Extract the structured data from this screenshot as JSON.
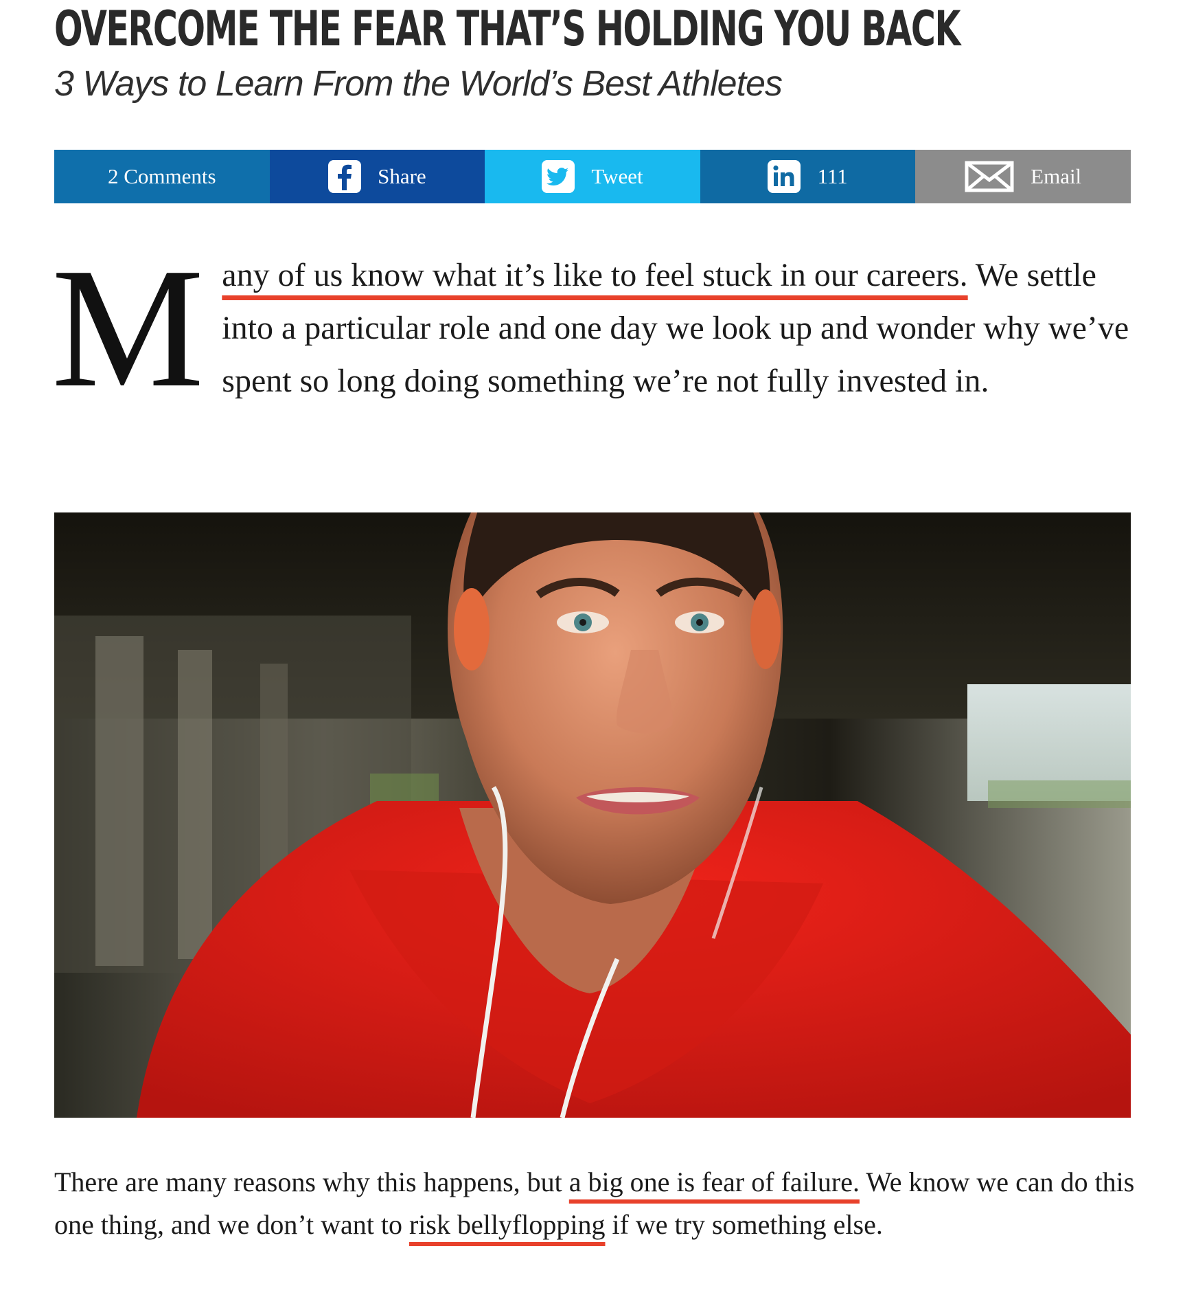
{
  "article": {
    "title": "Overcome the Fear That’s Holding You Back",
    "subtitle": "3 Ways to Learn From the World’s Best Athletes"
  },
  "share_bar": {
    "comments_label": "2 Comments",
    "share_label": "Share",
    "tweet_label": "Tweet",
    "linkedin_count": "111",
    "email_label": "Email",
    "colors": {
      "comments": "#0f6fab",
      "facebook": "#0d4a9c",
      "twitter": "#19b9ef",
      "linkedin": "#0f6aa3",
      "email": "#8c8c8c"
    },
    "icons": [
      "facebook-icon",
      "twitter-icon",
      "linkedin-icon",
      "envelope-icon"
    ]
  },
  "intro": {
    "drop_cap": "M",
    "highlighted": "any of us know what it’s like to feel stuck in our careers.",
    "rest": " We settle into a particular role and one day we look up and wonder why we’ve spent so long doing something we’re not fully invested in."
  },
  "photo": {
    "subject": "athlete-portrait"
  },
  "para2": {
    "part1": "There are many reasons why this happens, but ",
    "highlight1": "a big one is fear of failure.",
    "part2": " We know we can do this one thing, and we don’t want to ",
    "highlight2": "risk bellyflopping",
    "part3": " if we try something else."
  },
  "accent_color": "#e8412b"
}
